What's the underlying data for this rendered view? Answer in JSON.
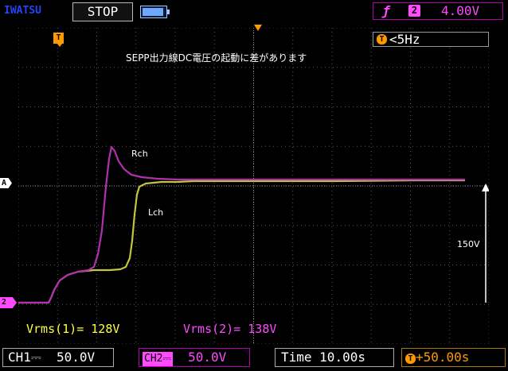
{
  "header": {
    "brand": "IWATSU",
    "run_state": "STOP",
    "trigger": {
      "slope_icon": "rising-edge",
      "source": "2",
      "level": "4.00V"
    }
  },
  "screen": {
    "trigger_position_marker": "T",
    "trigger_frequency": "<5Hz",
    "frequency_icon": "T",
    "annotation": "SEPP出力線DC電圧の起動に差があります",
    "trace_labels": {
      "rch": "Rch",
      "lch": "Lch"
    },
    "scale_label": "150V",
    "channel_markers": {
      "a": "A",
      "ch2": "2"
    },
    "measurements": {
      "vrms1": "Vrms(1)= 128V",
      "vrms2": "Vrms(2)= 138V"
    }
  },
  "footer": {
    "ch1": {
      "name": "CH1",
      "coupling": "⎓",
      "scale": "50.0V"
    },
    "ch2": {
      "name": "CH2",
      "coupling": "⎓",
      "scale": "50.0V"
    },
    "time": {
      "label": "Time",
      "value": "10.00s"
    },
    "offset": {
      "icon": "T",
      "value": "+50.00s"
    }
  },
  "colors": {
    "ch1": "#e0e040",
    "ch2": "#c040c0",
    "trigger": "#ff9900",
    "brand": "#2244ff"
  }
}
